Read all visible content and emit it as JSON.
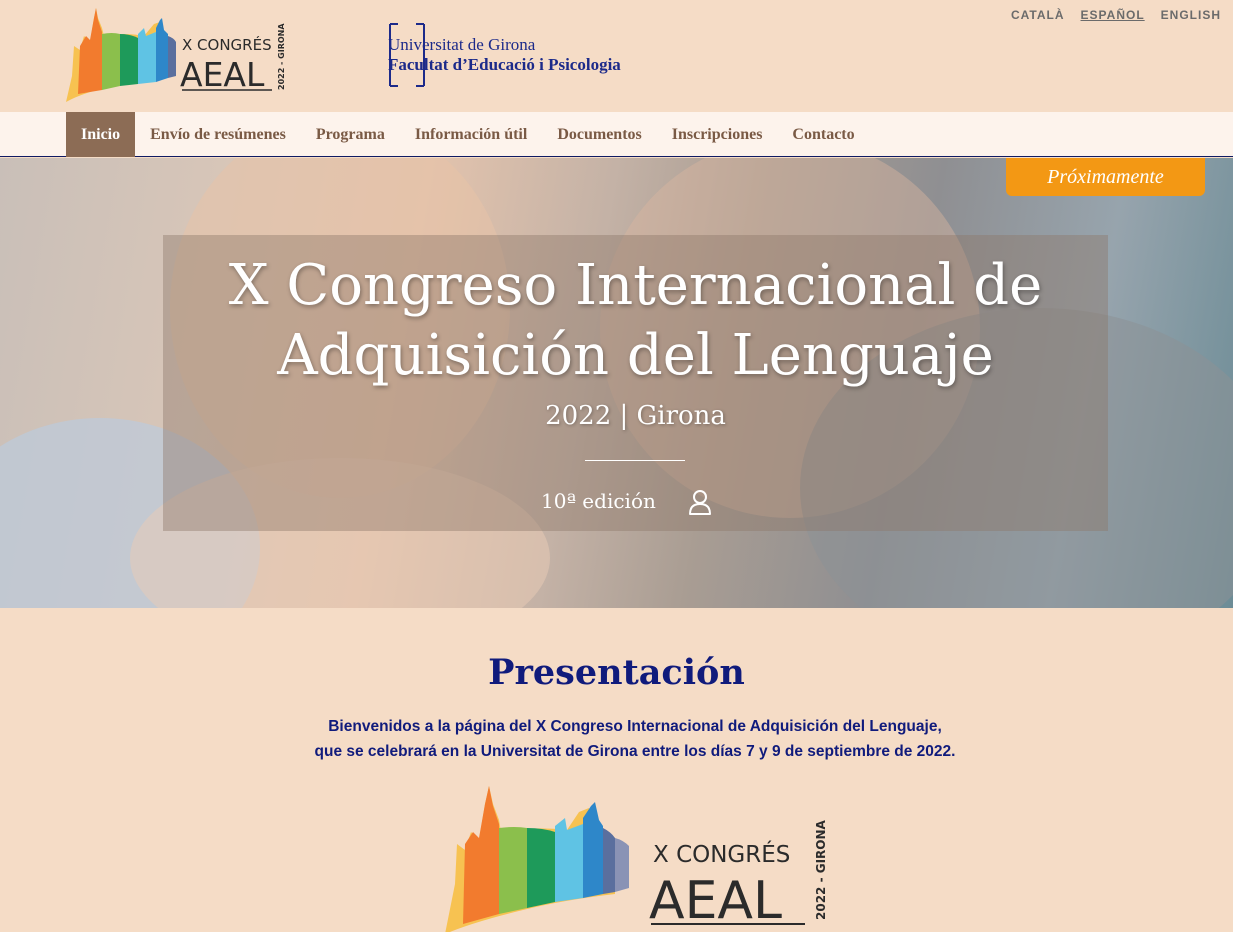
{
  "header": {
    "logo_text_top": "X CONGRÉS",
    "logo_text_main": "AEAL",
    "logo_text_side": "2022 - GIRONA",
    "university_line1": "Universitat de Girona",
    "university_line2": "Facultat d’Educació i Psicologia"
  },
  "languages": [
    {
      "label": "CATALÀ",
      "active": false
    },
    {
      "label": "ESPAÑOL",
      "active": true
    },
    {
      "label": "ENGLISH",
      "active": false
    }
  ],
  "nav": {
    "items": [
      {
        "label": "Inicio",
        "active": true
      },
      {
        "label": "Envío de resúmenes",
        "active": false
      },
      {
        "label": "Programa",
        "active": false
      },
      {
        "label": "Información útil",
        "active": false
      },
      {
        "label": "Documentos",
        "active": false
      },
      {
        "label": "Inscripciones",
        "active": false
      },
      {
        "label": "Contacto",
        "active": false
      }
    ]
  },
  "hero": {
    "title_line1": "X Congreso Internacional de",
    "title_line2": "Adquisición del Lenguaje",
    "subtitle": "2022 | Girona",
    "edition": "10ª edición",
    "badge": "Próximamente",
    "user_icon": "user-icon"
  },
  "presentation": {
    "title": "Presentación",
    "line1": "Bienvenidos a la página del X Congreso Internacional de Adquisición del Lenguaje,",
    "line2": "que se celebrará en la Universitat de Girona entre los días 7 y 9 de septiembre de 2022."
  },
  "colors": {
    "background": "#f5dcc6",
    "nav_active": "#8c6c55",
    "accent_orange": "#f39814",
    "heading_blue": "#101b7c"
  }
}
